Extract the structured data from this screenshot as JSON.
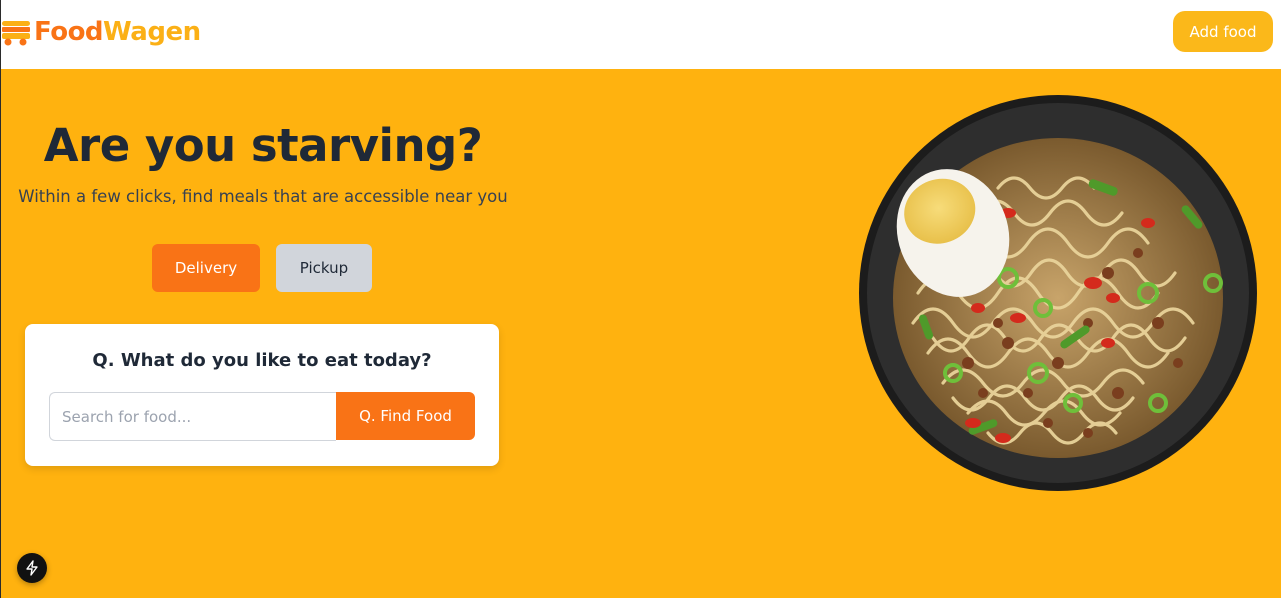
{
  "header": {
    "logo_food": "Food",
    "logo_wagen": "Wagen",
    "logo_icon": "food-truck-icon",
    "add_food_label": "Add food"
  },
  "hero": {
    "title": "Are you starving?",
    "subtitle": "Within a few clicks, find meals that are accessible near you",
    "tabs": [
      {
        "label": "Delivery",
        "active": true
      },
      {
        "label": "Pickup",
        "active": false
      }
    ],
    "search": {
      "question": "Q. What do you like to eat today?",
      "value": "",
      "placeholder": "Search for food...",
      "button_label": "Q. Find Food"
    },
    "image": "ramen-bowl-image"
  },
  "colors": {
    "brand_orange": "#f97316",
    "brand_yellow": "#ffb20f",
    "button_yellow": "#fbb81a",
    "text_dark": "#1f2937"
  },
  "dev_badge_icon": "lightning-icon"
}
